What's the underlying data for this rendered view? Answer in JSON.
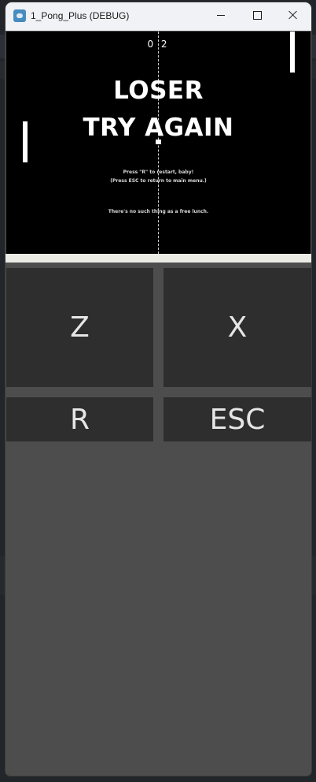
{
  "window": {
    "title": "1_Pong_Plus (DEBUG)",
    "icon": "godot-engine-icon",
    "controls": [
      "minimize",
      "maximize",
      "close"
    ]
  },
  "game": {
    "score": "0 2",
    "headline": "LOSER",
    "subheadline": "TRY AGAIN",
    "restart_hint": "Press \"R\" to restart, baby!",
    "menu_hint": "(Press ESC to return to main menu.)",
    "tagline": "There's no such thing as a free lunch."
  },
  "keys": {
    "z": "Z",
    "x": "X",
    "r": "R",
    "esc": "ESC"
  },
  "colors": {
    "titlebar": "#f0f2f5",
    "game_background": "#000000",
    "panel_background": "#4d4d4d",
    "key_background": "#2e2e2e",
    "key_text": "#e6e6e6",
    "divider": "#ebebe6"
  }
}
